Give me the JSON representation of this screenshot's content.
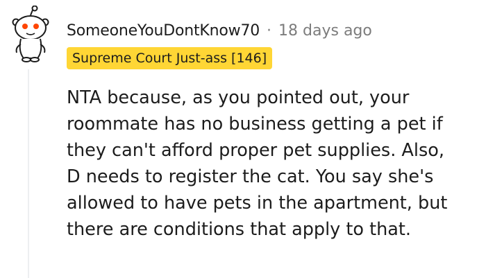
{
  "comment": {
    "author": "SomeoneYouDontKnow70",
    "separator": "·",
    "timestamp": "18 days ago",
    "flair": "Supreme Court Just-ass [146]",
    "avatar_icon": "reddit-snoo-icon",
    "body_lines": [
      "NTA because, as you pointed out, your",
      "roommate has no business getting a pet if",
      "they can't afford proper pet supplies. Also,",
      "D needs to register the cat. You say she's",
      "allowed to have pets in the apartment, but",
      "there are conditions that apply to that."
    ]
  },
  "colors": {
    "flair_background": "#ffd635",
    "avatar_eyes": "#ff4500",
    "muted_text": "#7c7c7c",
    "thread_line": "#edeff1"
  }
}
